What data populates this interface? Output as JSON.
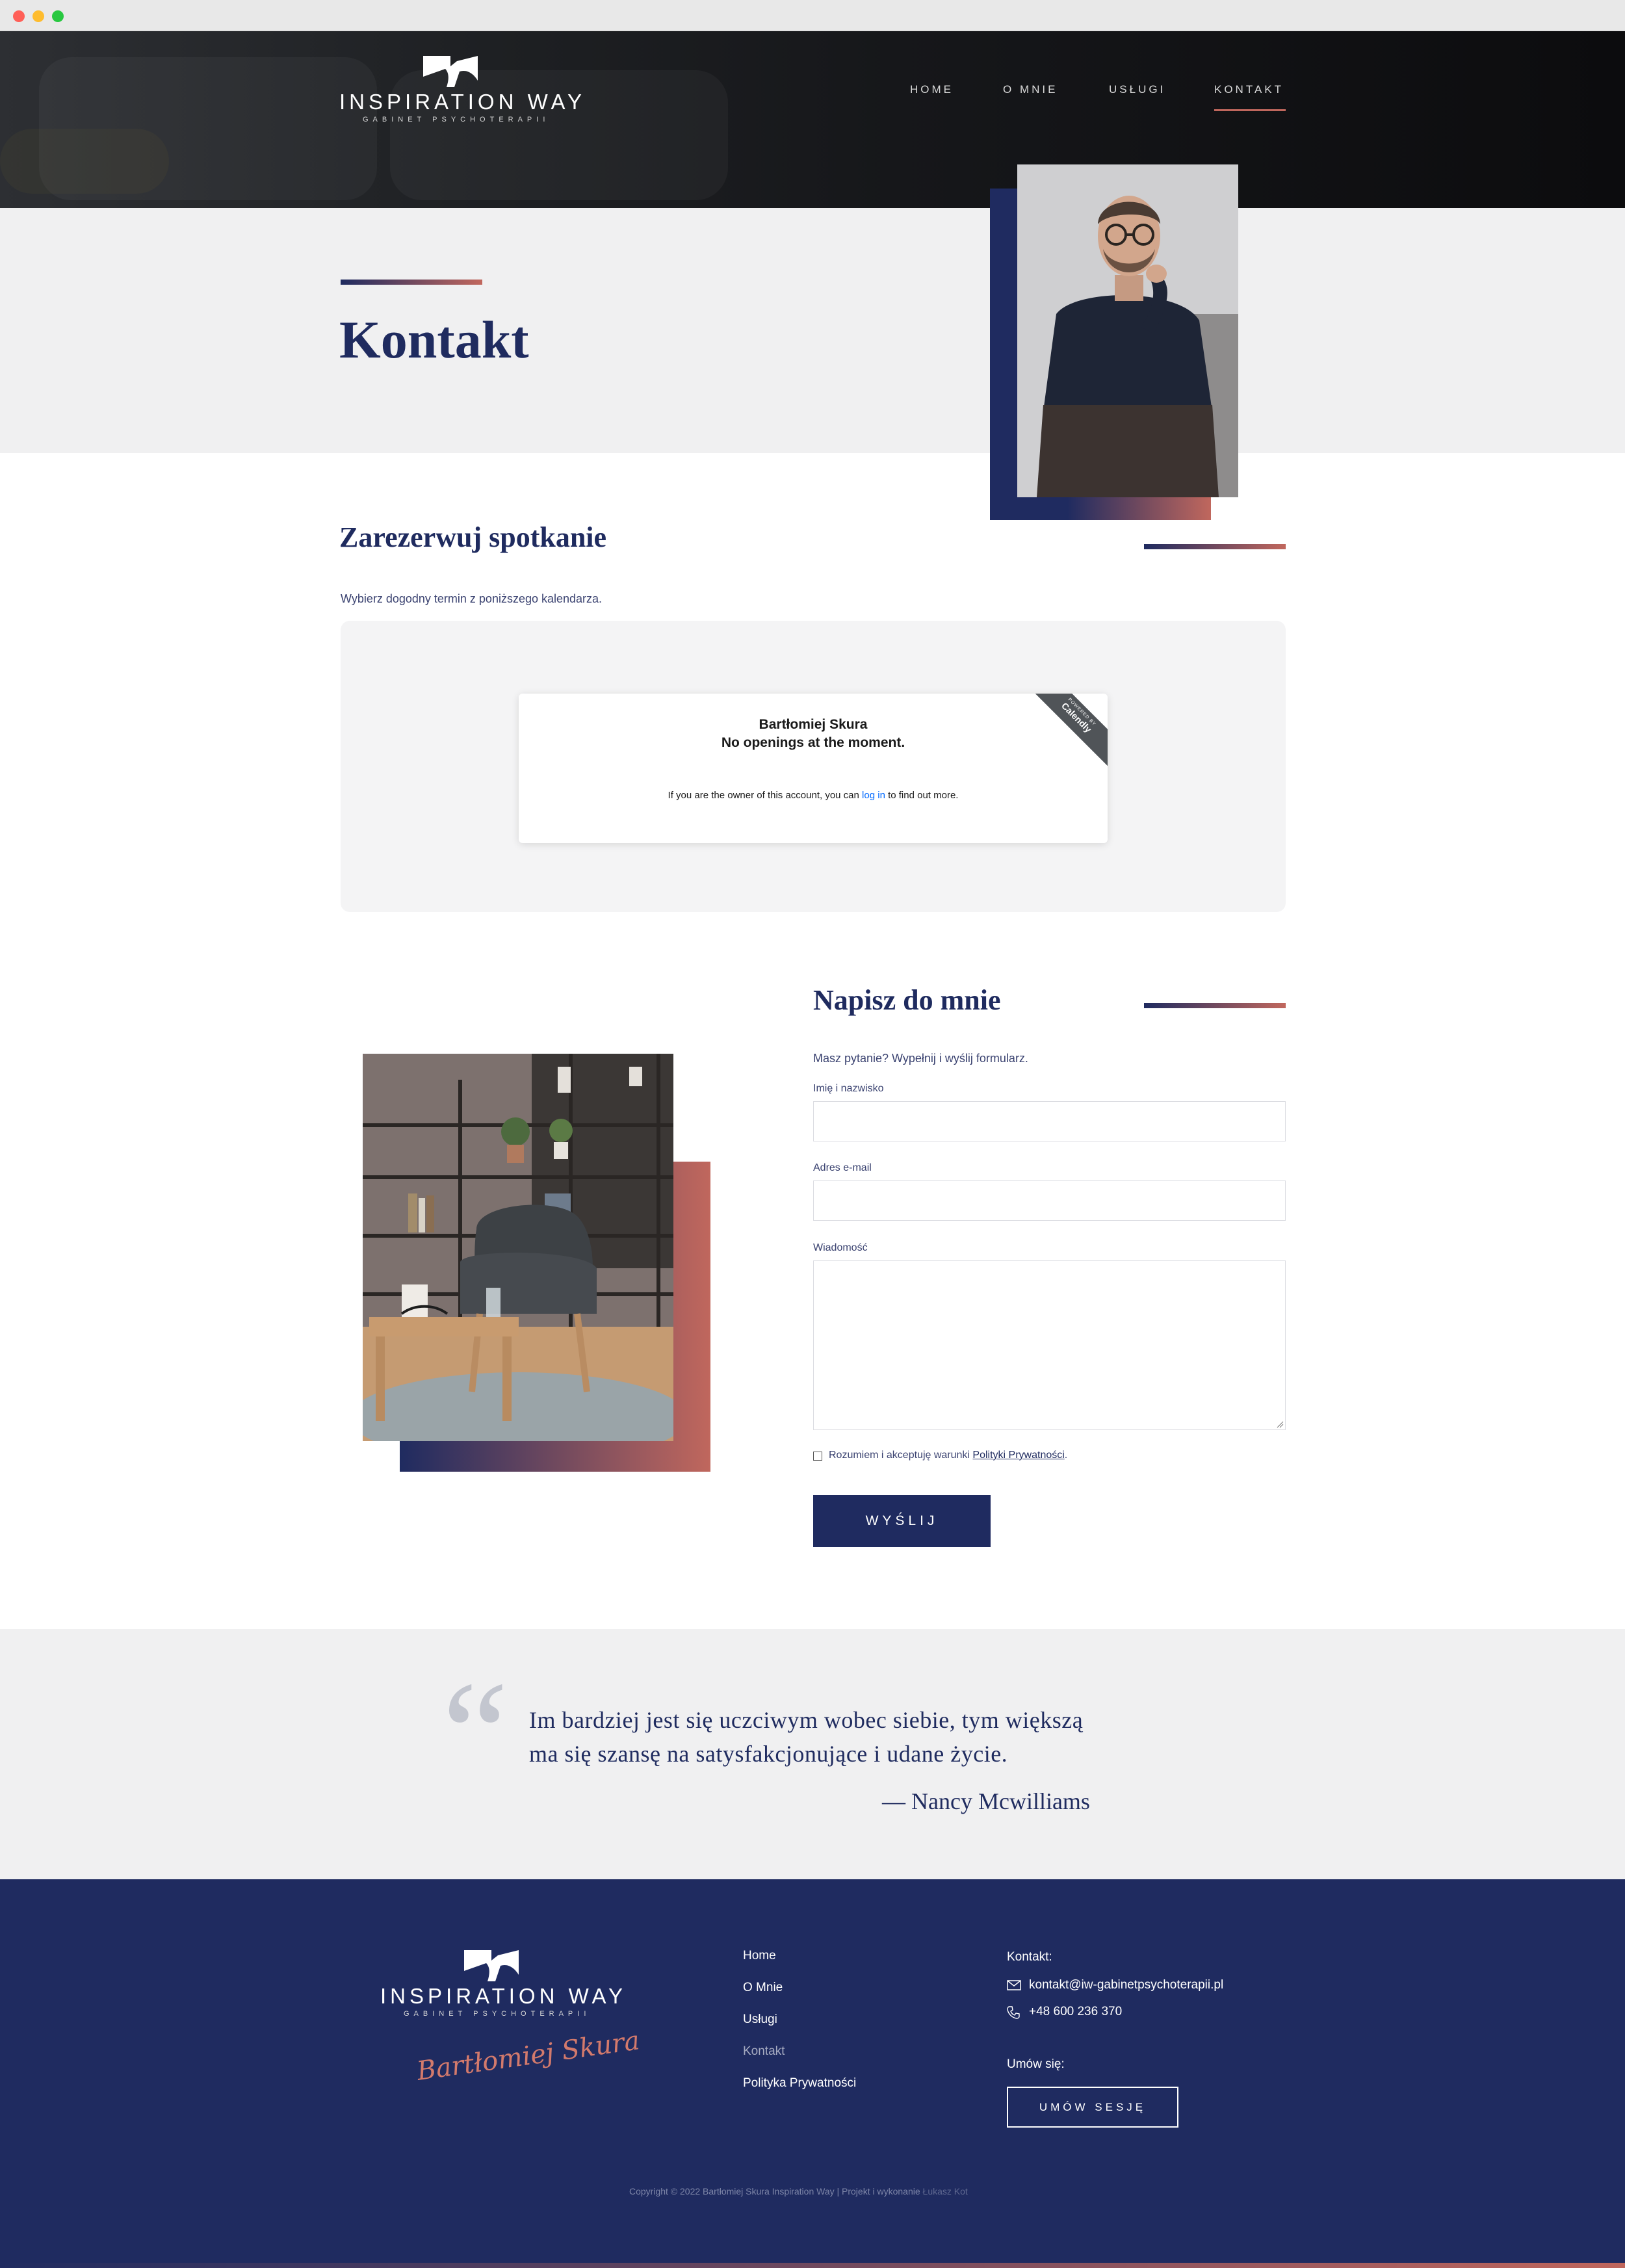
{
  "colors": {
    "navy": "#1f2b60",
    "accent": "#c0675d",
    "light_bg": "#f0f0f1",
    "calendly_link": "#0069ff"
  },
  "header": {
    "logo_title": "INSPIRATION WAY",
    "logo_subtitle": "GABINET PSYCHOTERAPII",
    "logo_icon": "logo-mark-icon",
    "nav": [
      {
        "label": "HOME",
        "active": false
      },
      {
        "label": "O MNIE",
        "active": false
      },
      {
        "label": "USŁUGI",
        "active": false
      },
      {
        "label": "KONTAKT",
        "active": true
      }
    ]
  },
  "page": {
    "title": "Kontakt"
  },
  "booking": {
    "heading": "Zarezerwuj spotkanie",
    "description": "Wybierz dogodny termin z poniższego kalendarza.",
    "calendly": {
      "name": "Bartłomiej Skura",
      "status": "No openings at the moment.",
      "message_before": "If you are the owner of this account, you can ",
      "message_link": "log in",
      "message_after": " to find out more.",
      "ribbon_small": "POWERED BY",
      "ribbon_brand": "Calendly"
    }
  },
  "contact_form": {
    "heading": "Napisz do mnie",
    "description": "Masz pytanie? Wypełnij i wyślij formularz.",
    "fields": {
      "name_label": "Imię i nazwisko",
      "email_label": "Adres e-mail",
      "message_label": "Wiadomość"
    },
    "consent_text": "Rozumiem i akceptuję warunki ",
    "consent_link": "Polityki Prywatności",
    "consent_end": ".",
    "submit_label": "WYŚLIJ"
  },
  "quote": {
    "mark": "“",
    "text": "Im bardziej jest się uczciwym wobec siebie, tym większą ma się szansę na satysfakcjonujące i udane życie.",
    "author": "— Nancy Mcwilliams"
  },
  "footer": {
    "logo_title": "INSPIRATION WAY",
    "logo_subtitle": "GABINET PSYCHOTERAPII",
    "signature": "Bartłomiej Skura",
    "links": [
      {
        "label": "Home",
        "active": false
      },
      {
        "label": "O Mnie",
        "active": false
      },
      {
        "label": "Usługi",
        "active": false
      },
      {
        "label": "Kontakt",
        "active": true
      },
      {
        "label": "Polityka Prywatności",
        "active": false
      }
    ],
    "contact_heading": "Kontakt:",
    "email": "kontakt@iw-gabinetpsychoterapii.pl",
    "email_icon": "envelope-icon",
    "phone": "+48 600 236 370",
    "phone_icon": "phone-icon",
    "book_heading": "Umów się:",
    "book_button": "UMÓW SESJĘ",
    "copyright_text": "Copyright © 2022 Bartłomiej Skura Inspiration Way | Projekt i wykonanie ",
    "copyright_author": "Łukasz Kot"
  }
}
